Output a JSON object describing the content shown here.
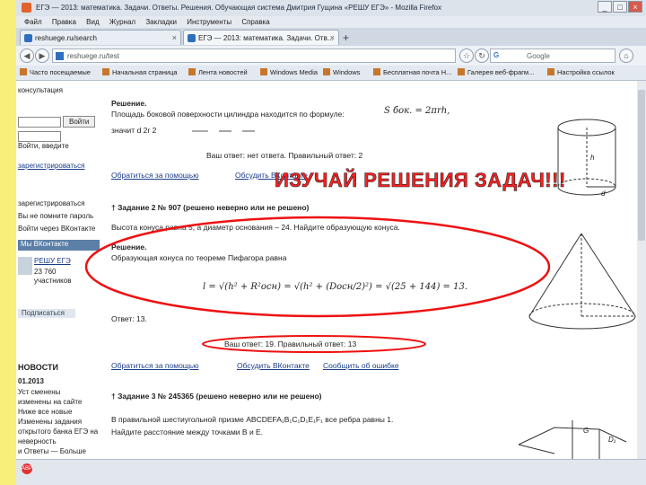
{
  "window": {
    "title": "ЕГЭ — 2013: математика. Задачи. Ответы. Решения. Обучающая система Дмитрия Гущина «РЕШУ ЕГЭ» - Mozilla Firefox"
  },
  "menu": [
    "Файл",
    "Правка",
    "Вид",
    "Журнал",
    "Закладки",
    "Инструменты",
    "Справка"
  ],
  "tabs": [
    {
      "label": "reshuege.ru/search"
    },
    {
      "label": "ЕГЭ — 2013: математика. Задачи. Отв..."
    }
  ],
  "address": {
    "url": "reshuege.ru/test"
  },
  "search": {
    "engine": "G",
    "placeholder": "Google"
  },
  "bookmarks": [
    "Часто посещаемые",
    "Начальная страница",
    "Лента новостей",
    "Windows Media",
    "Windows",
    "Бесплатная почта H...",
    "Галерея веб-фрагм...",
    "Настройка ссылок"
  ],
  "sidebar": {
    "consult": "консультация",
    "login_btn": "Войти",
    "login_hint": "Войти, введите",
    "reg": "зарегистрироваться",
    "forgot": "Вы не помните пароль",
    "vk_login": "Войти через ВКонтакте",
    "vk_header": "Мы ВКонтакте",
    "vk_name": "РЕШУ ЕГЭ",
    "vk_members": "23 760 участников",
    "vk_join": "Подписаться",
    "news_title": "НОВОСТИ",
    "news_date": "01.2013",
    "news_lines": [
      "Уст сменены",
      "изменены на сайте",
      "Ниже все новые",
      "Изменены задания",
      "открытого банка ЕГЭ на",
      "неверность",
      "и Ответы — Больше"
    ]
  },
  "main": {
    "sol1_header": "Решение.",
    "sol1_text": "Площадь боковой поверхности цилиндра находится по формуле:",
    "sol1_formula": "S бок. = 2πrh,",
    "sol1_text2": "значит  d   2r   2",
    "sol1_answer": "Ваш ответ: нет ответа. Правильный ответ: 2",
    "help1": "Обратиться за помощью",
    "discuss1": "Обсудить ВКонтакте",
    "task2_header": "† Задание 2 № 907 (решено неверно или не решено)",
    "task2_text": "Высота конуса равна 5, а диаметр основания – 24. Найдите образующую конуса.",
    "sol2_header": "Решение.",
    "sol2_text": "Образующая конуса по теореме Пифагора равна",
    "sol2_formula": "l = √(h² + R²осн) = √(h² + (Dосн/2)²) = √(25 + 144) = 13.",
    "sol2_answer": "Ответ: 13.",
    "your_answer": "Ваш ответ: 19. Правильный ответ: 13",
    "help2": "Обратиться за помощью",
    "discuss2": "Обсудить ВКонтакте",
    "report2": "Сообщить об ошибке",
    "task3_header": "† Задание 3 № 245365 (решено неверно или не решено)",
    "task3_text": "В правильной шестиугольной призме  ABCDEFA₁B₁C₁D₁E₁F₁  все ребра равны 1.",
    "task3_text2": "Найдите расстояние между точками  B  и  E."
  },
  "overlay": {
    "banner": "ИЗУЧАЙ РЕШЕНИЯ ЗАДАЧ!!!"
  },
  "figure_labels": {
    "cyl_h": "h",
    "cyl_d": "d",
    "prism_g": "G",
    "prism_d1": "D₁"
  },
  "colors": {
    "slide_bg": "#f6f07a",
    "annotation": "#e11",
    "banner": "#ff2020"
  }
}
